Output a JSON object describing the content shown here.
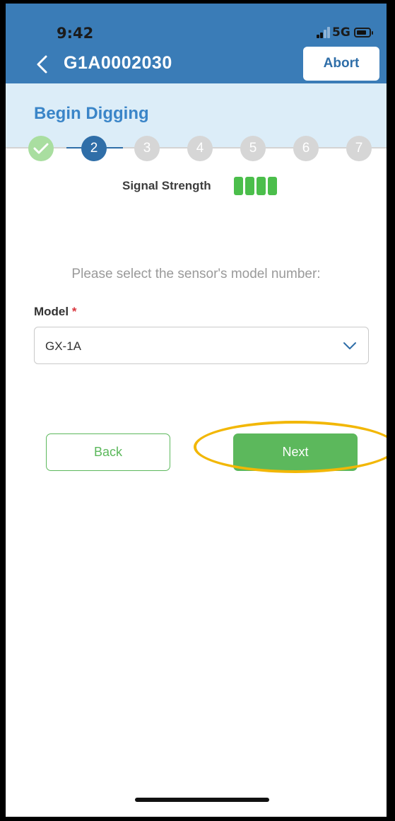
{
  "status_bar": {
    "time": "9:42",
    "network": "5G"
  },
  "header": {
    "title": "G1A0002030",
    "abort_label": "Abort"
  },
  "section": {
    "title": "Begin Digging"
  },
  "stepper": {
    "steps": [
      {
        "label": "",
        "state": "done"
      },
      {
        "label": "2",
        "state": "active"
      },
      {
        "label": "3",
        "state": "pending"
      },
      {
        "label": "4",
        "state": "pending"
      },
      {
        "label": "5",
        "state": "pending"
      },
      {
        "label": "6",
        "state": "pending"
      },
      {
        "label": "7",
        "state": "pending"
      }
    ]
  },
  "signal": {
    "label": "Signal Strength",
    "bars_filled": 4,
    "bars_total": 4
  },
  "form": {
    "prompt": "Please select the sensor's model number:",
    "model_label": "Model",
    "required_mark": "*",
    "model_value": "GX-1A"
  },
  "actions": {
    "back_label": "Back",
    "next_label": "Next"
  },
  "colors": {
    "header_blue": "#3a7cb7",
    "accent_green": "#5cb85c",
    "highlight_yellow": "#f2b705"
  }
}
